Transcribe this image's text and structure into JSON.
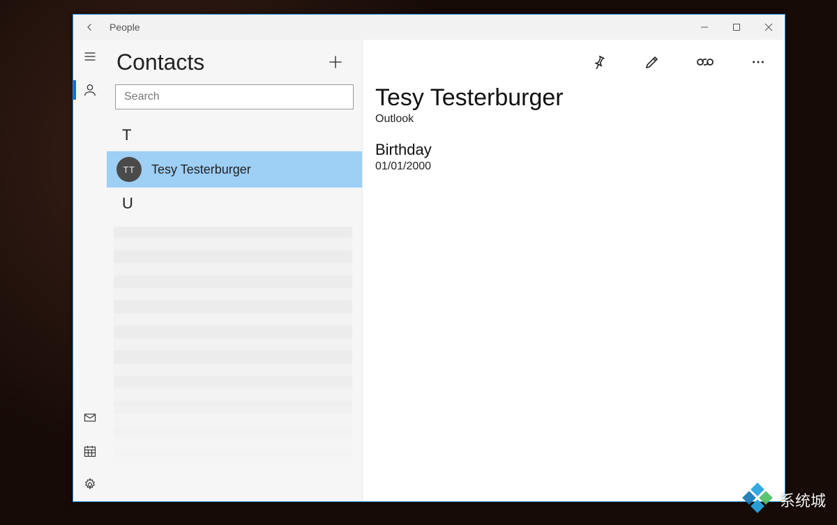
{
  "app": {
    "title": "People"
  },
  "window_controls": {
    "minimize": "Minimize",
    "maximize": "Maximize",
    "close": "Close"
  },
  "rail": {
    "hamburger": "Menu",
    "people": "People",
    "mail": "Mail",
    "calendar": "Calendar",
    "settings": "Settings"
  },
  "list": {
    "heading": "Contacts",
    "add_tooltip": "New contact",
    "search_placeholder": "Search",
    "sections": [
      {
        "letter": "T",
        "items": [
          {
            "initials": "TT",
            "name": "Tesy Testerburger",
            "selected": true
          }
        ]
      },
      {
        "letter": "U",
        "items": []
      }
    ]
  },
  "detail": {
    "toolbar": {
      "pin": "Pin to Start",
      "edit": "Edit",
      "link": "Link contacts",
      "more": "More"
    },
    "name": "Tesy Testerburger",
    "account": "Outlook",
    "fields": [
      {
        "label": "Birthday",
        "value": "01/01/2000"
      }
    ]
  },
  "watermark": {
    "text": "系统城"
  }
}
